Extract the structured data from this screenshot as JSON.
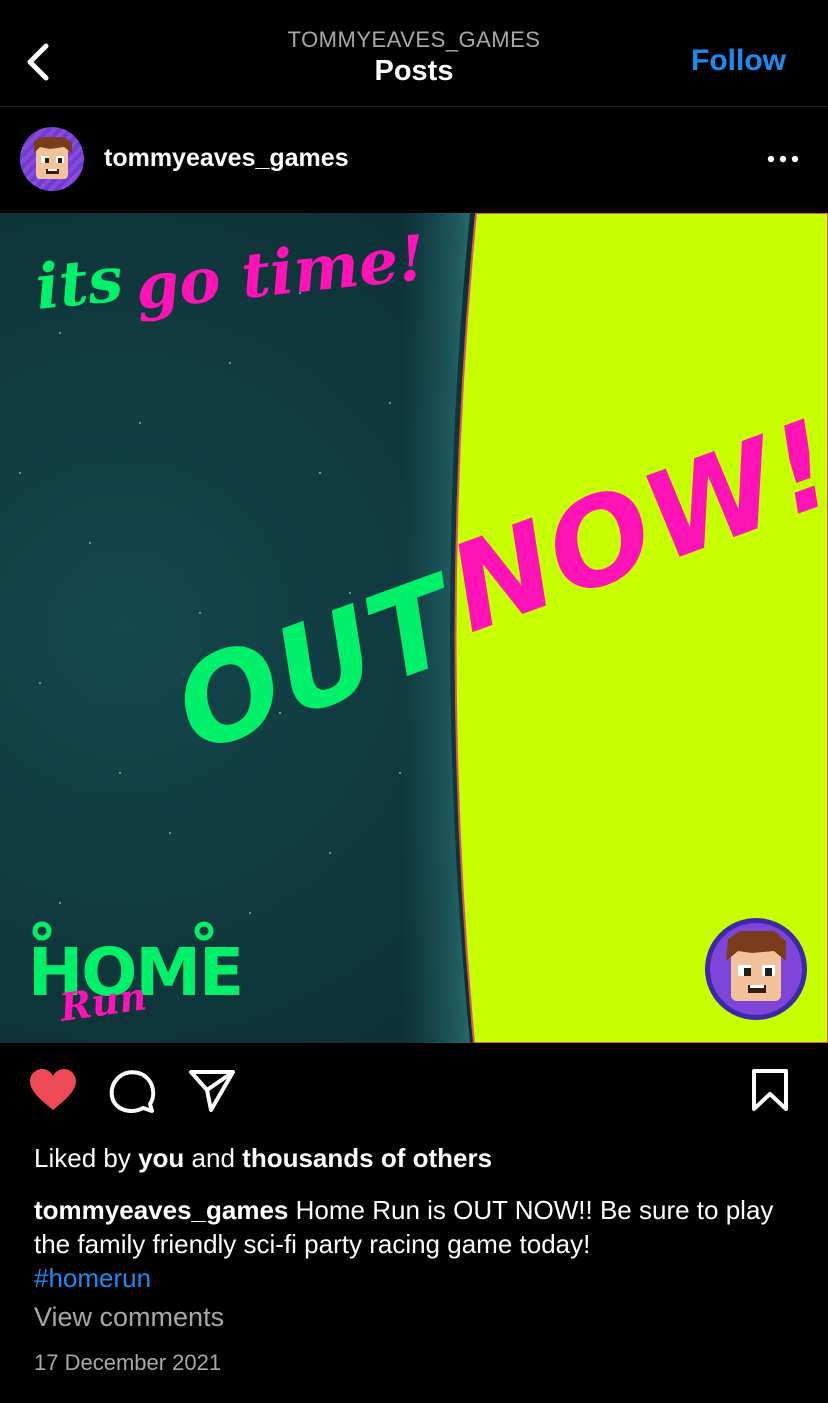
{
  "header": {
    "account": "TOMMYEAVES_GAMES",
    "title": "Posts",
    "follow_label": "Follow"
  },
  "post": {
    "username": "tommyeaves_games",
    "image": {
      "tagline": "its go time!",
      "tagline_word_1": "its",
      "tagline_word_2": "go time!",
      "headline_word_1": "OUT",
      "headline_word_2": "NOW!!",
      "logo_word_1": "HOME",
      "logo_word_2": "Run",
      "colors": {
        "space": "#0f3a3f",
        "planet": "#c8ff00",
        "green": "#00f06a",
        "pink": "#ff13b7"
      }
    },
    "actions": {
      "like_icon": "heart-icon",
      "comment_icon": "comment-icon",
      "share_icon": "share-icon",
      "save_icon": "bookmark-icon",
      "liked": true
    },
    "likes": {
      "prefix": "Liked by",
      "you": "you",
      "middle": "and",
      "others": "thousands of others"
    },
    "caption": {
      "username": "tommyeaves_games",
      "text": "Home Run is OUT NOW!! Be sure to play the family friendly sci-fi party racing game today!",
      "hashtag": "#homerun"
    },
    "view_comments": "View comments",
    "date": "17 December 2021"
  }
}
